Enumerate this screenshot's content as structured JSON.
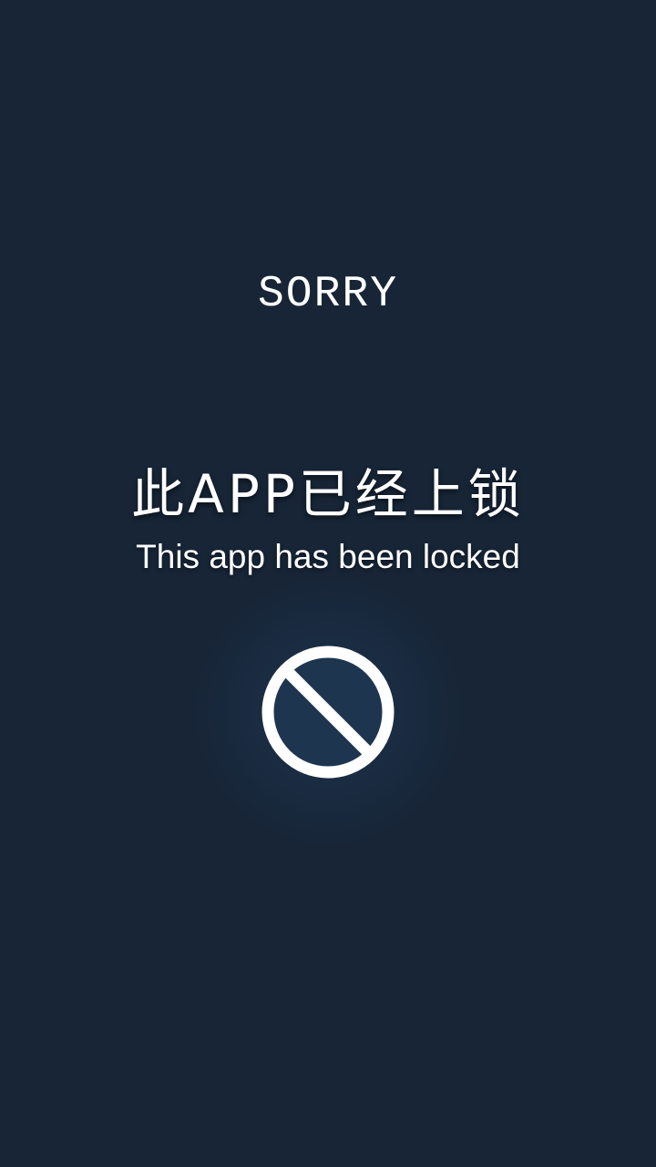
{
  "screen": {
    "sorry_label": "SORRY",
    "title_cn": "此APP已经上锁",
    "title_en": "This app has been locked",
    "icon": "prohibited-icon",
    "colors": {
      "background": "#172537",
      "text": "#ffffff",
      "icon_fill": "#1e3550"
    }
  }
}
